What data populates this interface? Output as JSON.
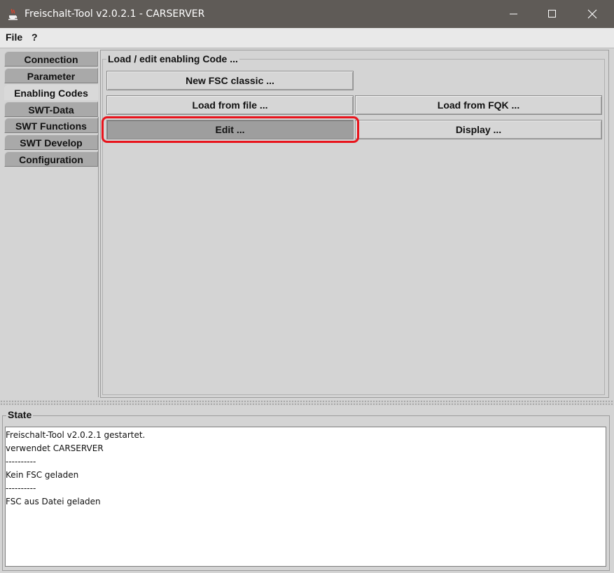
{
  "window": {
    "title": "Freischalt-Tool v2.0.2.1 - CARSERVER",
    "controls": [
      "minimize-icon",
      "maximize-icon",
      "close-icon"
    ]
  },
  "menu": {
    "file": "File",
    "help": "?"
  },
  "tabs": [
    {
      "label": "Connection",
      "selected": false
    },
    {
      "label": "Parameter",
      "selected": false
    },
    {
      "label": "Enabling Codes",
      "selected": true
    },
    {
      "label": "SWT-Data",
      "selected": false
    },
    {
      "label": "SWT Functions",
      "selected": false
    },
    {
      "label": "SWT Develop",
      "selected": false
    },
    {
      "label": "Configuration",
      "selected": false
    }
  ],
  "enabling": {
    "group_title": "Load / edit enabling Code ...",
    "new_fsc": "New FSC classic ...",
    "load_file": "Load from file ...",
    "load_fqk": "Load from FQK ...",
    "edit": "Edit ...",
    "display": "Display ..."
  },
  "state": {
    "title": "State",
    "log": [
      "Freischalt-Tool v2.0.2.1 gestartet.",
      "verwendet CARSERVER",
      "----------",
      "Kein FSC geladen",
      "----------",
      "FSC aus Datei geladen"
    ]
  },
  "colors": {
    "titlebar": "#5f5b57",
    "highlight": "#e8141c",
    "background": "#d4d4d4"
  }
}
